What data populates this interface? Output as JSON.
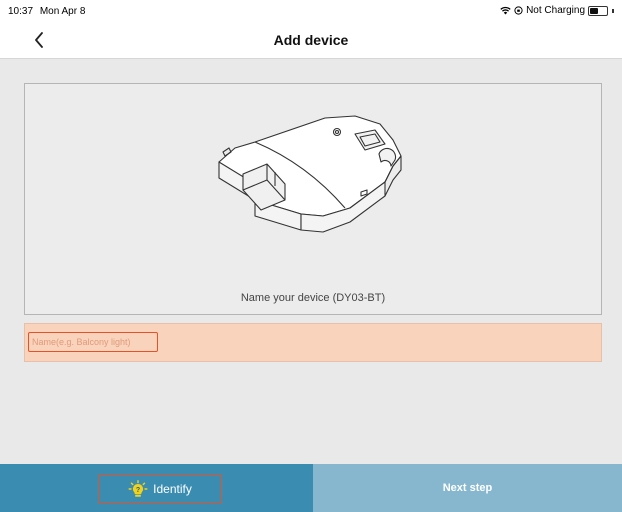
{
  "status_bar": {
    "time": "10:37",
    "date": "Mon Apr 8",
    "charging": "Not Charging",
    "battery_level": 0.45
  },
  "nav": {
    "title": "Add device",
    "back_icon": "chevron-left-icon"
  },
  "device": {
    "caption": "Name your device (DY03-BT)"
  },
  "name_field": {
    "placeholder": "Name(e.g. Balcony light)",
    "value": ""
  },
  "bottom": {
    "identify_label": "Identify",
    "identify_icon": "lightbulb-question-icon",
    "next_label": "Next step"
  },
  "colors": {
    "primary": "#3a8db1",
    "primary_light": "#86b7cf",
    "input_highlight": "#f9d3bc",
    "focus_border": "#e3532b"
  }
}
